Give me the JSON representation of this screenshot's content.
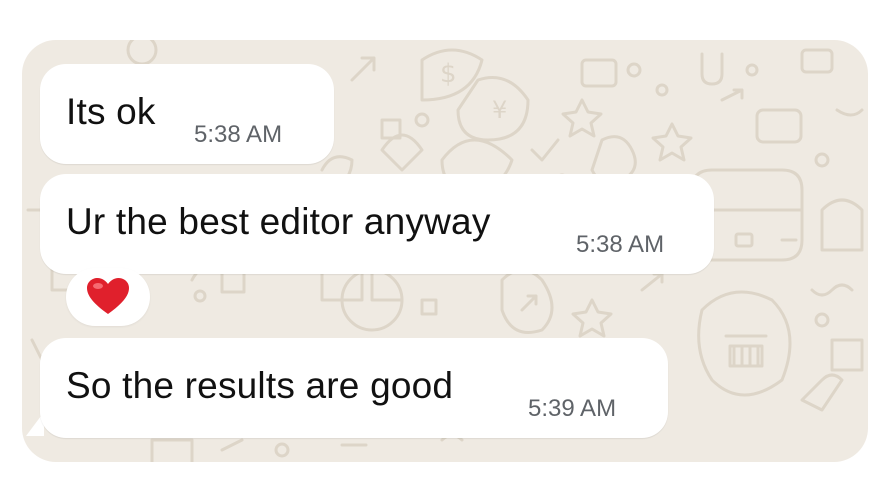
{
  "chat": {
    "messages": [
      {
        "text": "Its ok",
        "time": "5:38 AM"
      },
      {
        "text": "Ur the best editor anyway",
        "time": "5:38 AM"
      },
      {
        "text": "So the results are good",
        "time": "5:39 AM"
      }
    ],
    "reaction": {
      "emoji": "heart-icon",
      "color": "#e0202c"
    }
  },
  "colors": {
    "wallpaper": "#efeae2",
    "doodle": "#ddd5c8",
    "bubble": "#ffffff",
    "timestamp": "#5f6368"
  }
}
